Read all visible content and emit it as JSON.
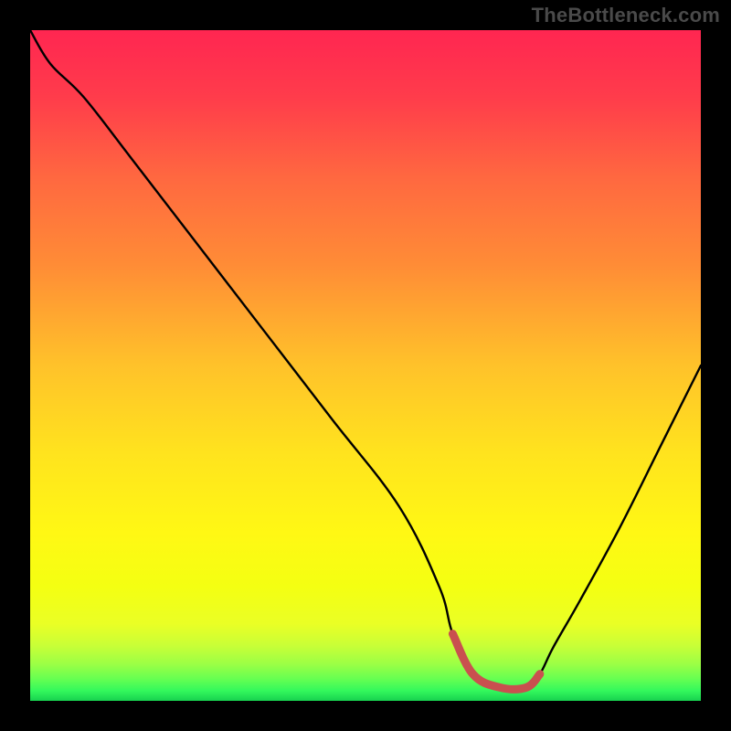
{
  "watermark": "TheBottleneck.com",
  "colors": {
    "highlight": "#c9504f",
    "curve": "#000000",
    "frame": "#000000"
  },
  "gradient_stops": [
    {
      "offset": 0.0,
      "color": "#ff2651"
    },
    {
      "offset": 0.1,
      "color": "#ff3c4b"
    },
    {
      "offset": 0.22,
      "color": "#ff6840"
    },
    {
      "offset": 0.35,
      "color": "#ff8c36"
    },
    {
      "offset": 0.5,
      "color": "#ffc22a"
    },
    {
      "offset": 0.63,
      "color": "#ffe31e"
    },
    {
      "offset": 0.75,
      "color": "#fff814"
    },
    {
      "offset": 0.83,
      "color": "#f4ff12"
    },
    {
      "offset": 0.885,
      "color": "#eaff25"
    },
    {
      "offset": 0.918,
      "color": "#c8ff37"
    },
    {
      "offset": 0.945,
      "color": "#9cff45"
    },
    {
      "offset": 0.968,
      "color": "#64ff52"
    },
    {
      "offset": 0.985,
      "color": "#33f85c"
    },
    {
      "offset": 1.0,
      "color": "#17d14f"
    }
  ],
  "chart_data": {
    "type": "line",
    "title": "",
    "xlabel": "",
    "ylabel": "",
    "xlim": [
      0,
      100
    ],
    "ylim": [
      0,
      100
    ],
    "series": [
      {
        "name": "bottleneck-curve",
        "x": [
          0,
          3,
          8,
          15,
          25,
          35,
          45,
          55,
          61,
          63,
          66,
          70,
          74,
          76,
          78,
          82,
          88,
          94,
          100
        ],
        "values": [
          100,
          95,
          90,
          81,
          68,
          55,
          42,
          29,
          17,
          10,
          4,
          2,
          2,
          4,
          8,
          15,
          26,
          38,
          50
        ]
      }
    ],
    "highlight_range": {
      "x_start": 63,
      "x_end": 76
    }
  }
}
